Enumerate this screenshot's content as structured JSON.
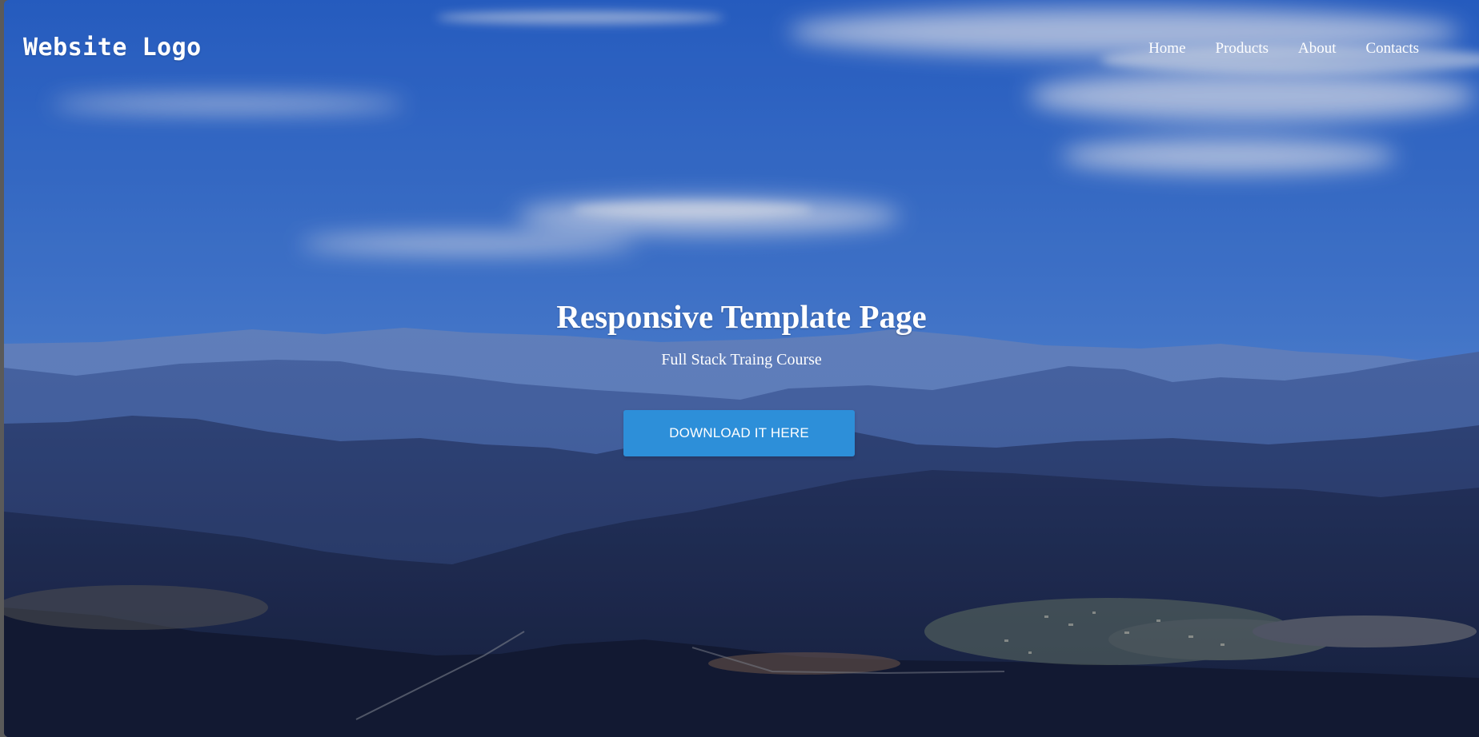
{
  "navbar": {
    "logo": "Website Logo",
    "links": [
      {
        "label": "Home"
      },
      {
        "label": "Products"
      },
      {
        "label": "About"
      },
      {
        "label": "Contacts"
      }
    ]
  },
  "hero": {
    "title": "Responsive Template Page",
    "subtitle": "Full Stack Traing Course",
    "button_label": "DOWNLOAD IT HERE"
  },
  "colors": {
    "sky_top": "#2f6fd6",
    "sky_horizon": "#7fa6e6",
    "mountains_far": "#5b79bb",
    "mountains_near": "#1e2a52",
    "button": "#2d8fd9",
    "text": "#ffffff"
  }
}
